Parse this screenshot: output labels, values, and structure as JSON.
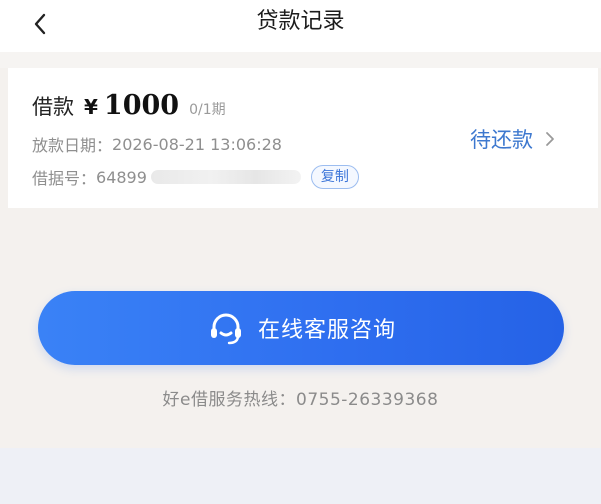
{
  "header": {
    "title": "贷款记录",
    "back_icon": "chevron-left-icon"
  },
  "loan": {
    "label": "借款",
    "currency": "¥",
    "amount": "1000",
    "term": "0/1期",
    "date_label": "放款日期：",
    "date_value": "2026-08-21 13:06:28",
    "id_label": "借据号：",
    "id_visible": "64899",
    "copy_label": "复制",
    "status": "待还款",
    "status_icon": "chevron-right-icon"
  },
  "contact": {
    "label": "在线客服咨询",
    "icon": "headset-icon"
  },
  "hotline": {
    "text": "好e借服务热线：0755-26339368"
  },
  "colors": {
    "accent": "#2f6ff0",
    "status_blue": "#3d78cf",
    "page_bg": "#f4f1ee"
  }
}
